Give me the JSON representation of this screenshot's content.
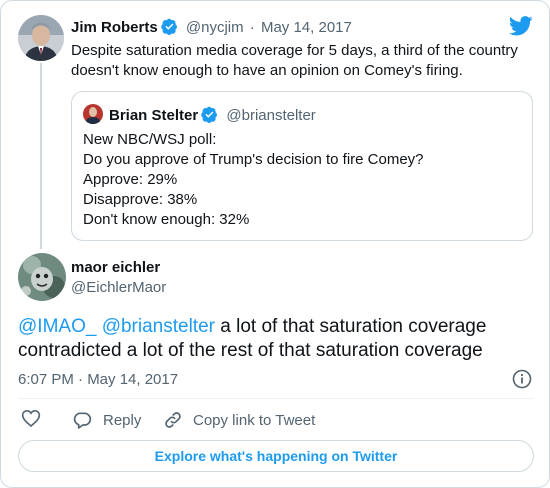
{
  "original_tweet": {
    "display_name": "Jim Roberts",
    "handle": "@nycjim",
    "separator": "·",
    "date": "May 14, 2017",
    "text": "Despite saturation media coverage for 5 days, a third of the country doesn't know enough to have an opinion on Comey's firing."
  },
  "quoted_tweet": {
    "display_name": "Brian Stelter",
    "handle": "@brianstelter",
    "lines": [
      "New NBC/WSJ poll:",
      "Do you approve of Trump's decision to fire Comey?",
      "Approve: 29%",
      "Disapprove: 38%",
      "Don't know enough: 32%"
    ]
  },
  "reply_tweet": {
    "display_name": "maor eichler",
    "handle": "@EichlerMaor",
    "mention_1": "@IMAO_",
    "mention_2": "@brianstelter",
    "text_part_1": " a lot of that saturation coverage",
    "text_part_2": "contradicted a lot of the rest of that saturation coverage",
    "timestamp": "6:07 PM · May 14, 2017"
  },
  "actions": {
    "reply_label": "Reply",
    "copy_link_label": "Copy link to Tweet"
  },
  "explore_button_label": "Explore what's happening on Twitter",
  "colors": {
    "brand_blue": "#1d9bf0",
    "text": "#0f1419",
    "muted": "#536471",
    "border": "#cfd9de"
  }
}
